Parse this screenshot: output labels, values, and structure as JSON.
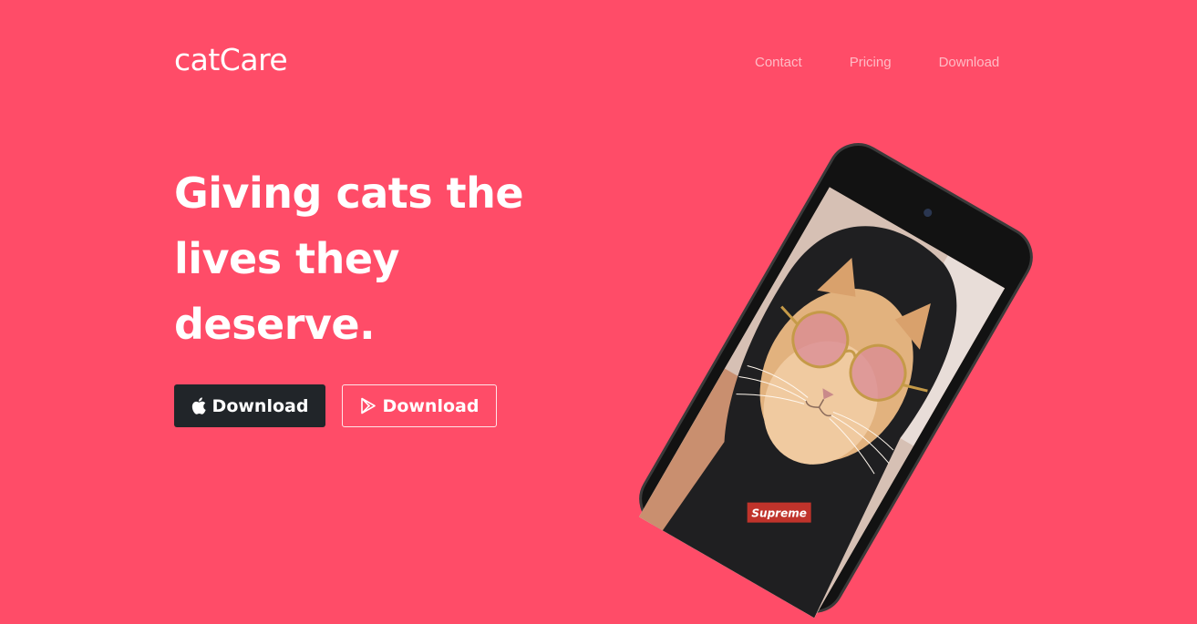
{
  "brand": "catCare",
  "nav": {
    "items": [
      {
        "label": "Contact"
      },
      {
        "label": "Pricing"
      },
      {
        "label": "Download"
      }
    ]
  },
  "hero": {
    "lines": [
      "Giving cats the",
      "lives they",
      "deserve."
    ],
    "buttons": {
      "apple": {
        "label": "Download",
        "icon": "apple-icon"
      },
      "play": {
        "label": "Download",
        "icon": "google-play-icon"
      }
    }
  },
  "phone": {
    "hoodie_text": "Supreme"
  },
  "colors": {
    "background": "#ff4c68",
    "dark_button": "#212529"
  }
}
